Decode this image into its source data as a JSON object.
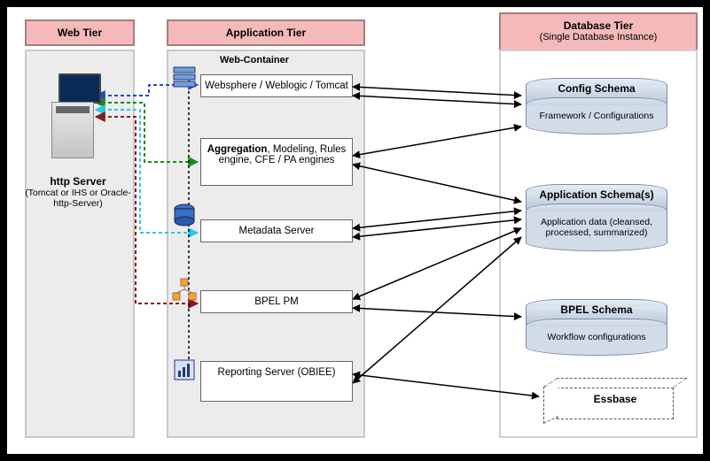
{
  "tiers": {
    "web": {
      "title": "Web Tier"
    },
    "app": {
      "title": "Application Tier"
    },
    "db": {
      "title": "Database Tier",
      "subtitle": "(Single Database Instance)"
    }
  },
  "web": {
    "server_label": "http Server",
    "server_sub": "(Tomcat or IHS or Oracle-http-Server)"
  },
  "app": {
    "container_label": "Web-Container",
    "boxes": [
      {
        "id": "websphere",
        "html": "Websphere / Weblogic / Tomcat",
        "icon": "stack-icon"
      },
      {
        "id": "engines",
        "html": "<b>Aggregation</b>, Modeling, Rules engine, CFE / PA engines",
        "icon": null
      },
      {
        "id": "metadata",
        "html": "Metadata Server",
        "icon": "db-icon"
      },
      {
        "id": "bpel",
        "html": "BPEL PM",
        "icon": "workflow-icon"
      },
      {
        "id": "reporting",
        "html": "Reporting Server (OBIEE)",
        "icon": "report-icon"
      }
    ]
  },
  "db": {
    "schemas": [
      {
        "id": "config",
        "title": "Config Schema",
        "desc": "Framework / Configurations"
      },
      {
        "id": "appdata",
        "title": "Application Schema(s)",
        "desc": "Application data (cleansed, processed, summarized)"
      },
      {
        "id": "bpel",
        "title": "BPEL Schema",
        "desc": "Workflow configurations"
      }
    ],
    "essbase": "Essbase"
  },
  "connections": [
    {
      "from": "http-server",
      "to": "websphere",
      "style": "blue-dashed",
      "dir": "both"
    },
    {
      "from": "http-server",
      "to": "engines",
      "style": "green-dashed",
      "dir": "both"
    },
    {
      "from": "http-server",
      "to": "metadata",
      "style": "cyan-dashed",
      "dir": "both"
    },
    {
      "from": "http-server",
      "to": "bpel",
      "style": "darkred-dashed",
      "dir": "both"
    },
    {
      "from": "websphere",
      "to": "reporting",
      "style": "black-dashed",
      "dir": "down-chain"
    },
    {
      "from": "app-tier",
      "to": "config-schema",
      "style": "black-solid",
      "dir": "both"
    },
    {
      "from": "app-tier",
      "to": "application-schema",
      "style": "black-solid",
      "dir": "both"
    },
    {
      "from": "app-tier",
      "to": "bpel-schema",
      "style": "black-solid",
      "dir": "both"
    },
    {
      "from": "app-tier",
      "to": "essbase",
      "style": "black-solid",
      "dir": "both"
    }
  ]
}
